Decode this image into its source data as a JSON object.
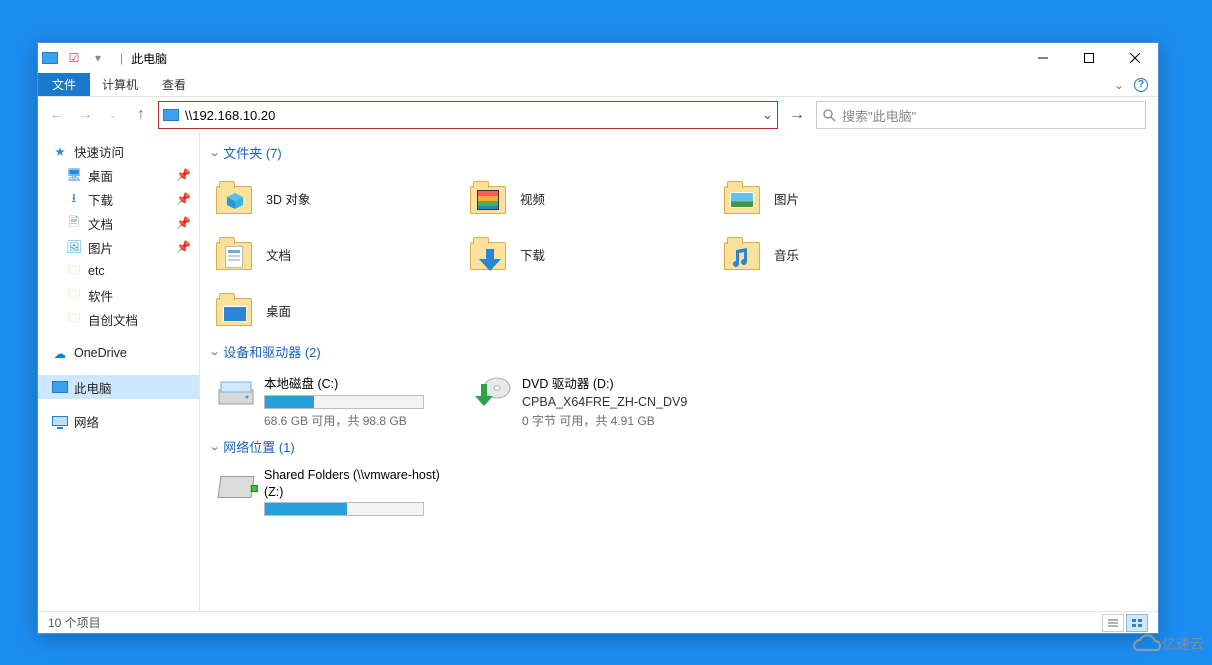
{
  "window": {
    "title": "此电脑",
    "qat_sep": "|"
  },
  "ribbon": {
    "file": "文件",
    "computer": "计算机",
    "view": "查看",
    "help_symbol": "?"
  },
  "nav": {
    "address_text": "\\\\192.168.10.20",
    "dropdown_glyph": "⌄",
    "go_glyph": "→",
    "search_placeholder": "搜索\"此电脑\""
  },
  "sidebar": {
    "quick_access": "快速访问",
    "desktop": "桌面",
    "downloads": "下载",
    "documents": "文档",
    "pictures": "图片",
    "etc": "etc",
    "software": "软件",
    "self_doc": "自创文档",
    "onedrive": "OneDrive",
    "this_pc": "此电脑",
    "network": "网络"
  },
  "groups": {
    "folders_head": "文件夹 (7)",
    "drives_head": "设备和驱动器 (2)",
    "network_head": "网络位置 (1)"
  },
  "folders": {
    "objects3d": "3D 对象",
    "videos": "视频",
    "pictures": "图片",
    "documents": "文档",
    "downloads": "下载",
    "music": "音乐",
    "desktop": "桌面"
  },
  "drives": {
    "c": {
      "name": "本地磁盘 (C:)",
      "sub": "68.6 GB 可用，共 98.8 GB",
      "fill_pct": 31
    },
    "d": {
      "name": "DVD 驱动器 (D:)",
      "label": "CPBA_X64FRE_ZH-CN_DV9",
      "sub": "0 字节 可用，共 4.91 GB"
    }
  },
  "netloc": {
    "z": {
      "name": "Shared Folders (\\\\vmware-host)",
      "label": "(Z:)",
      "fill_pct": 52
    }
  },
  "status": {
    "item_count": "10 个项目"
  },
  "watermark": "亿速云"
}
